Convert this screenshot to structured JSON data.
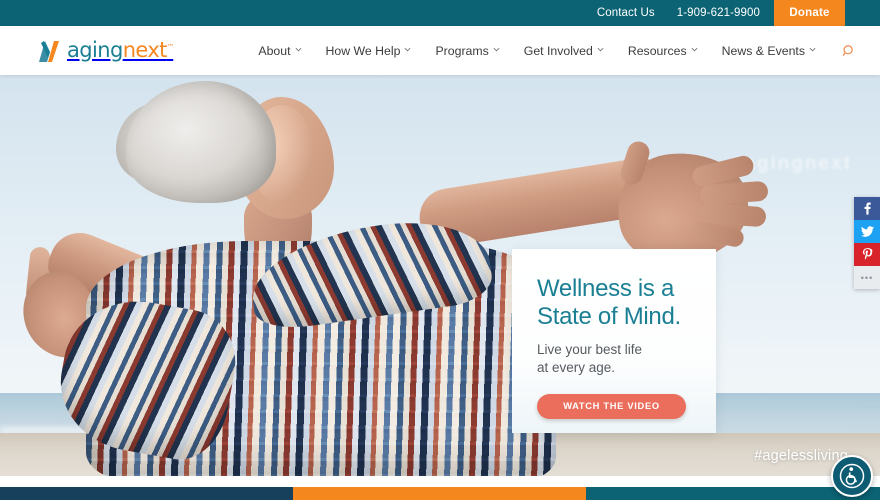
{
  "topbar": {
    "contact_label": "Contact Us",
    "phone": "1-909-621-9900",
    "donate_label": "Donate",
    "bg_color": "#0b6374",
    "donate_color": "#f5871f"
  },
  "brand": {
    "name_part1": "aging",
    "name_part2": "next",
    "trademark": "™",
    "teal": "#1a7f94",
    "orange": "#f5871f",
    "logo_icon": "aging-next-n-mark"
  },
  "nav": {
    "items": [
      {
        "label": "About",
        "has_dropdown": true
      },
      {
        "label": "How We Help",
        "has_dropdown": true
      },
      {
        "label": "Programs",
        "has_dropdown": true
      },
      {
        "label": "Get Involved",
        "has_dropdown": true
      },
      {
        "label": "Resources",
        "has_dropdown": true
      },
      {
        "label": "News & Events",
        "has_dropdown": true
      }
    ],
    "search_icon": "search-icon"
  },
  "hero": {
    "watermark_text": "agingnext",
    "headline_line1": "Wellness is a",
    "headline_line2": "State of Mind.",
    "subhead_line1": "Live your best life",
    "subhead_line2": "at every age.",
    "cta_label": "WATCH THE VIDEO",
    "cta_color": "#eb6e5d",
    "headline_color": "#1b7f94",
    "hashtag": "#agelessliving",
    "image_alt": "Senior woman with arms outstretched at the beach"
  },
  "social": {
    "items": [
      {
        "name": "facebook",
        "glyph": "f",
        "color": "#3b5998"
      },
      {
        "name": "twitter",
        "glyph": "t",
        "color": "#1da1f2"
      },
      {
        "name": "pinterest",
        "glyph": "p",
        "color": "#d8232a"
      },
      {
        "name": "more",
        "glyph": "•••",
        "color": "#e9ecef"
      }
    ]
  },
  "accessibility": {
    "label": "Accessibility options",
    "icon": "wheelchair-icon",
    "color": "#0e5c73"
  },
  "footer_strip": {
    "segments": [
      {
        "name": "navy",
        "color": "#17405c"
      },
      {
        "name": "orange",
        "color": "#f5871f"
      },
      {
        "name": "teal",
        "color": "#0b6374"
      }
    ]
  }
}
